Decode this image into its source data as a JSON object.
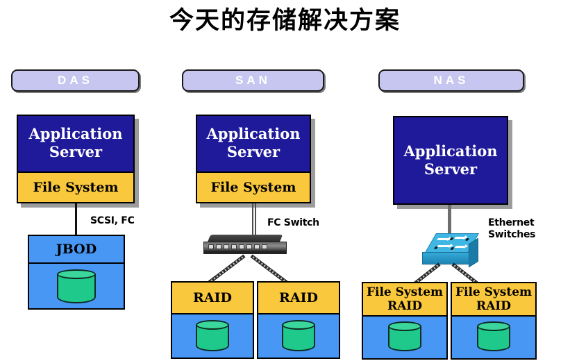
{
  "title": "今天的存储解决方案",
  "colors": {
    "pill_fill": "#c6c6f0",
    "server_fill": "#1f1a99",
    "filesystem_fill": "#fac83c",
    "storage_fill": "#4897f5",
    "disk_fill": "#1ec98b",
    "shadow": "#9c9c9c",
    "ethernet_switch": "#34a9d8",
    "fc_switch": "#3a3a3a"
  },
  "columns": [
    {
      "id": "das",
      "header": "DAS",
      "server": {
        "line1": "Application",
        "line2": "Server",
        "filesystem_label": "File System",
        "has_filesystem": true
      },
      "link_label": "SCSI, FC",
      "switch": null,
      "storage": [
        {
          "head_lines": [
            "JBOD"
          ],
          "head_style": "plain",
          "has_disk": true
        }
      ]
    },
    {
      "id": "san",
      "header": "SAN",
      "server": {
        "line1": "Application",
        "line2": "Server",
        "filesystem_label": "File System",
        "has_filesystem": true
      },
      "link_label": "FC Switch",
      "switch": "fc-switch",
      "storage": [
        {
          "head_lines": [
            "RAID"
          ],
          "head_style": "amber",
          "has_disk": true
        },
        {
          "head_lines": [
            "RAID"
          ],
          "head_style": "amber",
          "has_disk": true
        }
      ]
    },
    {
      "id": "nas",
      "header": "NAS",
      "server": {
        "line1": "Application",
        "line2": "Server",
        "filesystem_label": "",
        "has_filesystem": false
      },
      "link_label_line1": "Ethernet",
      "link_label_line2": "Switches",
      "switch": "ethernet-switch",
      "storage": [
        {
          "head_lines": [
            "File System",
            "RAID"
          ],
          "head_style": "amber",
          "has_disk": true
        },
        {
          "head_lines": [
            "File System",
            "RAID"
          ],
          "head_style": "amber",
          "has_disk": true
        }
      ]
    }
  ]
}
